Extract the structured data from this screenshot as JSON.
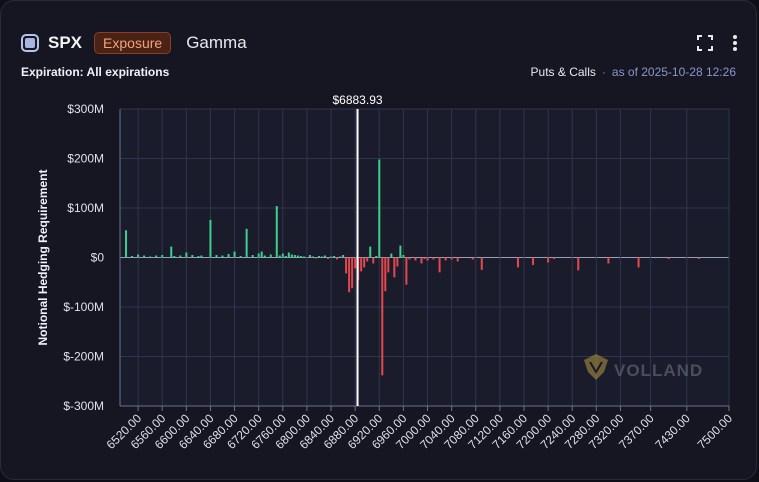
{
  "header": {
    "ticker": "SPX",
    "badge": "Exposure",
    "metric": "Gamma"
  },
  "subheader": {
    "expiration_label": "Expiration: All expirations",
    "puts_calls": "Puts & Calls",
    "separator": "·",
    "as_of": "as of 2025-10-28 12:26"
  },
  "icons": [
    "expand-icon",
    "more-vertical-icon",
    "volland-logo-icon"
  ],
  "watermark": "VOLLAND",
  "colors": {
    "positive": "#3ecf8e",
    "negative": "#e5484d",
    "spot_line": "#ffffff",
    "badge": "#f5a27a"
  },
  "chart_data": {
    "type": "bar",
    "ylabel": "Notional Hedging Requirement",
    "ylim": [
      -300000000,
      300000000
    ],
    "yticks": [
      300000000,
      200000000,
      100000000,
      0,
      -100000000,
      -200000000,
      -300000000
    ],
    "ytick_labels": [
      "$300M",
      "$200M",
      "$100M",
      "$0",
      "$-100M",
      "$-200M",
      "$-300M"
    ],
    "xlim": [
      6490,
      7500
    ],
    "xtick_values": [
      6520,
      6560,
      6600,
      6640,
      6680,
      6720,
      6760,
      6800,
      6840,
      6880,
      6920,
      6960,
      7000,
      7040,
      7080,
      7120,
      7160,
      7200,
      7240,
      7280,
      7320,
      7370,
      7430,
      7500
    ],
    "xtick_labels": [
      "6520.00",
      "6560.00",
      "6600.00",
      "6640.00",
      "6680.00",
      "6720.00",
      "6760.00",
      "6800.00",
      "6840.00",
      "6880.00",
      "6920.00",
      "6960.00",
      "7000.00",
      "7040.00",
      "7080.00",
      "7120.00",
      "7160.00",
      "7200.00",
      "7240.00",
      "7280.00",
      "7320.00",
      "7370.00",
      "7430.00",
      "7500.00"
    ],
    "grid": true,
    "spot": {
      "value": 6883.93,
      "label": "$6883.93"
    },
    "units": "USD",
    "bars": [
      {
        "x": 6500,
        "y": 55000000
      },
      {
        "x": 6510,
        "y": 3000000
      },
      {
        "x": 6520,
        "y": 6000000
      },
      {
        "x": 6530,
        "y": 4000000
      },
      {
        "x": 6540,
        "y": 2000000
      },
      {
        "x": 6550,
        "y": 4000000
      },
      {
        "x": 6560,
        "y": 5000000
      },
      {
        "x": 6575,
        "y": 22000000
      },
      {
        "x": 6580,
        "y": 3000000
      },
      {
        "x": 6590,
        "y": 4000000
      },
      {
        "x": 6600,
        "y": 10000000
      },
      {
        "x": 6610,
        "y": 5000000
      },
      {
        "x": 6620,
        "y": 3000000
      },
      {
        "x": 6625,
        "y": 4000000
      },
      {
        "x": 6640,
        "y": 76000000
      },
      {
        "x": 6650,
        "y": 5000000
      },
      {
        "x": 6660,
        "y": 4000000
      },
      {
        "x": 6670,
        "y": 7000000
      },
      {
        "x": 6680,
        "y": 12000000
      },
      {
        "x": 6690,
        "y": 3000000
      },
      {
        "x": 6700,
        "y": 58000000
      },
      {
        "x": 6710,
        "y": 5000000
      },
      {
        "x": 6720,
        "y": 8000000
      },
      {
        "x": 6725,
        "y": 12000000
      },
      {
        "x": 6730,
        "y": 4000000
      },
      {
        "x": 6740,
        "y": 6000000
      },
      {
        "x": 6750,
        "y": 104000000
      },
      {
        "x": 6755,
        "y": 4000000
      },
      {
        "x": 6760,
        "y": 8000000
      },
      {
        "x": 6765,
        "y": 3000000
      },
      {
        "x": 6770,
        "y": 10000000
      },
      {
        "x": 6775,
        "y": 6000000
      },
      {
        "x": 6780,
        "y": 5000000
      },
      {
        "x": 6785,
        "y": 4000000
      },
      {
        "x": 6790,
        "y": 3000000
      },
      {
        "x": 6795,
        "y": 2000000
      },
      {
        "x": 6805,
        "y": 5000000
      },
      {
        "x": 6810,
        "y": 2000000
      },
      {
        "x": 6815,
        "y": -2000000
      },
      {
        "x": 6820,
        "y": 3000000
      },
      {
        "x": 6825,
        "y": 2000000
      },
      {
        "x": 6830,
        "y": 4000000
      },
      {
        "x": 6835,
        "y": -3000000
      },
      {
        "x": 6840,
        "y": 2000000
      },
      {
        "x": 6845,
        "y": 3000000
      },
      {
        "x": 6850,
        "y": -4000000
      },
      {
        "x": 6855,
        "y": 2000000
      },
      {
        "x": 6860,
        "y": 5000000
      },
      {
        "x": 6865,
        "y": -32000000
      },
      {
        "x": 6870,
        "y": -70000000
      },
      {
        "x": 6875,
        "y": -62000000
      },
      {
        "x": 6880,
        "y": -22000000
      },
      {
        "x": 6885,
        "y": -46000000
      },
      {
        "x": 6890,
        "y": -28000000
      },
      {
        "x": 6895,
        "y": -20000000
      },
      {
        "x": 6900,
        "y": -8000000
      },
      {
        "x": 6905,
        "y": 22000000
      },
      {
        "x": 6910,
        "y": -12000000
      },
      {
        "x": 6915,
        "y": 3000000
      },
      {
        "x": 6920,
        "y": 198000000
      },
      {
        "x": 6925,
        "y": -238000000
      },
      {
        "x": 6930,
        "y": -68000000
      },
      {
        "x": 6935,
        "y": -30000000
      },
      {
        "x": 6940,
        "y": 8000000
      },
      {
        "x": 6945,
        "y": -40000000
      },
      {
        "x": 6950,
        "y": -18000000
      },
      {
        "x": 6955,
        "y": 24000000
      },
      {
        "x": 6960,
        "y": 5000000
      },
      {
        "x": 6965,
        "y": -55000000
      },
      {
        "x": 6970,
        "y": -4000000
      },
      {
        "x": 6980,
        "y": -6000000
      },
      {
        "x": 6990,
        "y": -12000000
      },
      {
        "x": 6995,
        "y": -3000000
      },
      {
        "x": 7000,
        "y": -6000000
      },
      {
        "x": 7010,
        "y": -4000000
      },
      {
        "x": 7020,
        "y": -30000000
      },
      {
        "x": 7030,
        "y": -6000000
      },
      {
        "x": 7040,
        "y": -4000000
      },
      {
        "x": 7050,
        "y": -8000000
      },
      {
        "x": 7075,
        "y": -4000000
      },
      {
        "x": 7090,
        "y": -25000000
      },
      {
        "x": 7150,
        "y": -20000000
      },
      {
        "x": 7175,
        "y": -15000000
      },
      {
        "x": 7200,
        "y": -10000000
      },
      {
        "x": 7210,
        "y": -3000000
      },
      {
        "x": 7250,
        "y": -26000000
      },
      {
        "x": 7300,
        "y": -12000000
      },
      {
        "x": 7350,
        "y": -20000000
      },
      {
        "x": 7400,
        "y": -3000000
      },
      {
        "x": 7450,
        "y": -3000000
      }
    ]
  }
}
